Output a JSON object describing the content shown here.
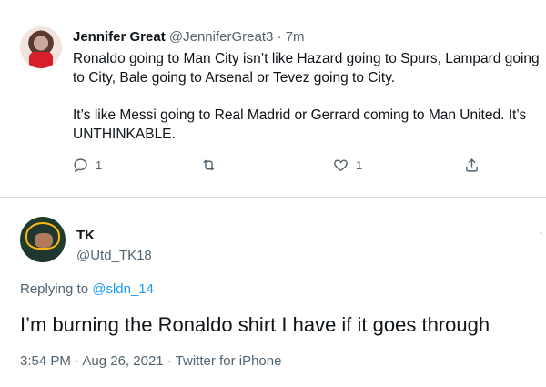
{
  "tweet1": {
    "name": "Jennifer Great",
    "handle": "@JenniferGreat3",
    "separator": "·",
    "time": "7m",
    "para1": "Ronaldo going to Man City isn’t like Hazard going to Spurs, Lampard going to City, Bale going to Arsenal or Tevez going to City.",
    "para2": "It’s like Messi going to Real Madrid or Gerrard coming to Man United. It’s UNTHINKABLE.",
    "reply_count": "1",
    "like_count": "1",
    "icons": [
      "reply-icon",
      "retweet-icon",
      "like-icon",
      "share-icon"
    ]
  },
  "tweet2": {
    "name": "TK",
    "handle": "@Utd_TK18",
    "more": "·",
    "replying_prefix": "Replying to",
    "replying_to": "@sldn_14",
    "text": "I’m burning the Ronaldo shirt I have if it goes through",
    "time": "3:54 PM",
    "sep1": "·",
    "date": "Aug 26, 2021",
    "sep2": "·",
    "client": "Twitter for iPhone"
  },
  "colors": {
    "text": "#0f1419",
    "muted": "#536471",
    "link": "#1d9bf0",
    "divider": "#d8dde1"
  }
}
